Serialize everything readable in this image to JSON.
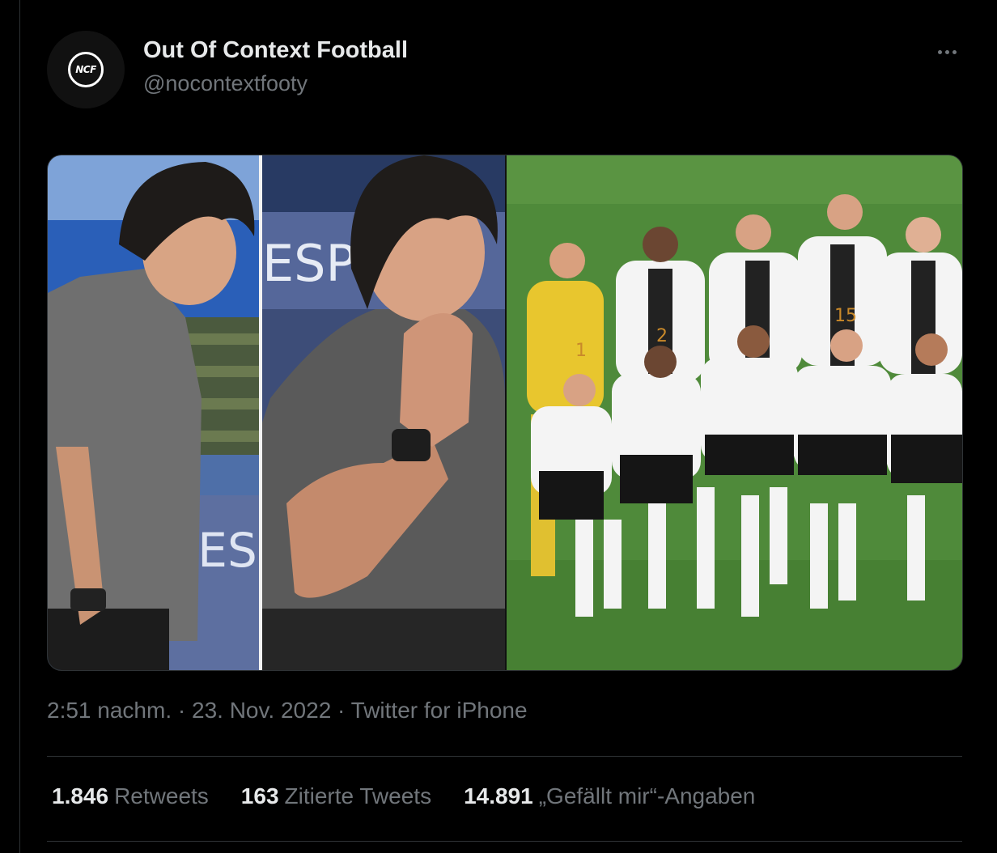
{
  "tweet": {
    "author_name": "Out Of Context Football",
    "author_handle": "@nocontextfooty",
    "avatar_text": "NCF",
    "time": "2:51 nachm.",
    "date": "23. Nov. 2022",
    "source": "Twitter for iPhone",
    "separator": "·"
  },
  "media": {
    "panel1_sign": "RESI",
    "panel2_sign": "ESP",
    "jersey_numbers": [
      "1",
      "2",
      "15"
    ]
  },
  "stats": [
    {
      "count": "1.846",
      "label": "Retweets"
    },
    {
      "count": "163",
      "label": "Zitierte Tweets"
    },
    {
      "count": "14.891",
      "label": "„Gefällt mir“-Angaben"
    }
  ],
  "colors": {
    "background": "#000000",
    "text_primary": "#e7e9ea",
    "text_secondary": "#71767b",
    "border": "#2f3336",
    "pitch_green": "#4f8a3a"
  },
  "icons": {
    "more": "more-horizontal-icon"
  }
}
